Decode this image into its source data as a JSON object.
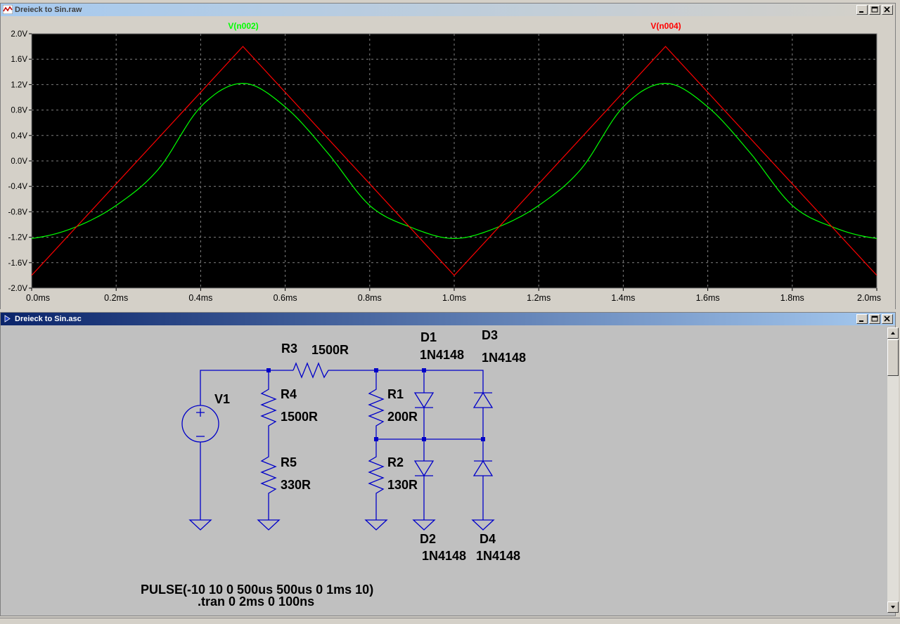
{
  "plot_window": {
    "title": "Dreieck to Sin.raw",
    "traces": [
      {
        "name": "V(n002)",
        "color": "#00ff00"
      },
      {
        "name": "V(n004)",
        "color": "#ff0000"
      }
    ]
  },
  "schematic_window": {
    "title": "Dreieck to Sin.asc",
    "components": [
      {
        "ref": "V1",
        "value": ""
      },
      {
        "ref": "R3",
        "value": "1500R"
      },
      {
        "ref": "R4",
        "value": "1500R"
      },
      {
        "ref": "R5",
        "value": "330R"
      },
      {
        "ref": "R1",
        "value": "200R"
      },
      {
        "ref": "R2",
        "value": "130R"
      },
      {
        "ref": "D1",
        "value": "1N4148"
      },
      {
        "ref": "D2",
        "value": "1N4148"
      },
      {
        "ref": "D3",
        "value": "1N4148"
      },
      {
        "ref": "D4",
        "value": "1N4148"
      }
    ],
    "directives": [
      "PULSE(-10 10 0 500us 500us 0 1ms 10)",
      ".tran 0 2ms 0 100ns"
    ]
  },
  "chart_data": {
    "type": "line",
    "title": "",
    "xlabel": "",
    "ylabel": "",
    "xlim": [
      0,
      2.0
    ],
    "ylim": [
      -2.0,
      2.0
    ],
    "x_unit": "ms",
    "y_unit": "V",
    "x_ticks": [
      "0.0ms",
      "0.2ms",
      "0.4ms",
      "0.6ms",
      "0.8ms",
      "1.0ms",
      "1.2ms",
      "1.4ms",
      "1.6ms",
      "1.8ms",
      "2.0ms"
    ],
    "y_ticks": [
      "2.0V",
      "1.6V",
      "1.2V",
      "0.8V",
      "0.4V",
      "0.0V",
      "-0.4V",
      "-0.8V",
      "-1.2V",
      "-1.6V",
      "-2.0V"
    ],
    "grid": true,
    "series": [
      {
        "name": "V(n004)",
        "color": "#ff0000",
        "x": [
          0,
          0.5,
          1.0,
          1.5,
          2.0
        ],
        "y": [
          -1.8,
          1.8,
          -1.8,
          1.8,
          -1.8
        ]
      },
      {
        "name": "V(n002)",
        "color": "#00ff00",
        "x": [
          0,
          0.1,
          0.2,
          0.3,
          0.4,
          0.5,
          0.6,
          0.7,
          0.8,
          0.9,
          1.0,
          1.1,
          1.2,
          1.3,
          1.4,
          1.5,
          1.6,
          1.7,
          1.8,
          1.9,
          2.0
        ],
        "y": [
          -1.22,
          -1.05,
          -0.7,
          -0.13,
          0.85,
          1.22,
          0.85,
          0.13,
          -0.7,
          -1.05,
          -1.22,
          -1.05,
          -0.7,
          -0.13,
          0.85,
          1.22,
          0.85,
          0.13,
          -0.7,
          -1.05,
          -1.22
        ]
      }
    ]
  }
}
